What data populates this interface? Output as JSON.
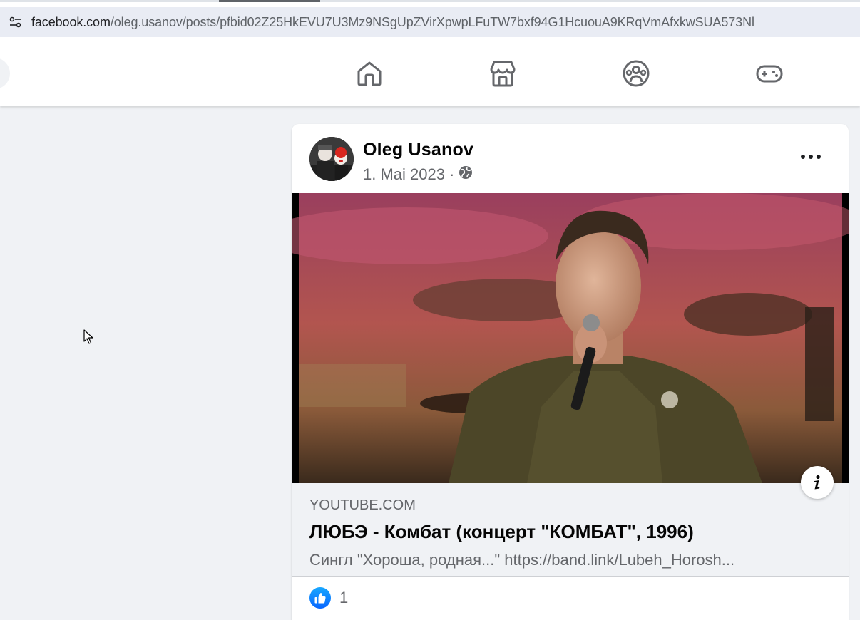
{
  "browser": {
    "url_host": "facebook.com",
    "url_path": "/oleg.usanov/posts/pfbid02Z25HkEVU7U3Mz9NSgUpZVirXpwpLFuTW7bxf94G1HcuouA9KRqVmAfxkwSUA573Nl",
    "site_info_icon": "tune-icon"
  },
  "nav": {
    "icons": [
      "home-icon",
      "marketplace-icon",
      "groups-icon",
      "gaming-icon"
    ]
  },
  "post": {
    "author": "Oleg Usanov",
    "date": "1. Mai 2023",
    "separator": "·",
    "audience_icon": "globe-icon",
    "link": {
      "domain": "YOUTUBE.COM",
      "title": "ЛЮБЭ - Комбат (концерт \"КОМБАТ\", 1996)",
      "description": "Сингл \"Хороша, родная...\" https://band.link/Lubeh_Horosh..."
    },
    "reactions": {
      "count": "1"
    }
  },
  "colors": {
    "accent": "#0866ff",
    "page_bg": "#f0f2f5",
    "text_secondary": "#65676b"
  }
}
